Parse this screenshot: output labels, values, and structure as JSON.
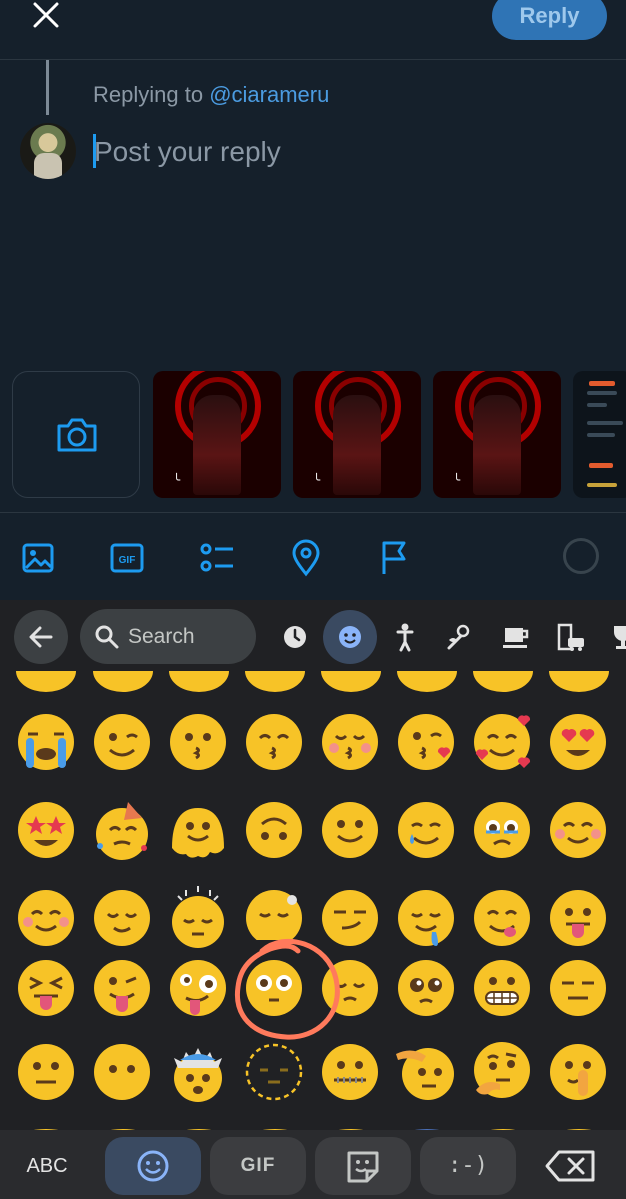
{
  "header": {
    "close_label": "✕",
    "reply_button": "Reply"
  },
  "reply": {
    "replying_prefix": "Replying to ",
    "replying_handle": "@ciarameru",
    "placeholder": "Post your reply"
  },
  "media_strip": {
    "camera_icon": "camera-icon",
    "thumbnails": [
      {
        "icon": "image"
      },
      {
        "icon": "image"
      },
      {
        "icon": "image"
      }
    ]
  },
  "toolbar": {
    "icons": [
      "image-icon",
      "gif-icon",
      "poll-icon",
      "location-icon",
      "flag-icon"
    ],
    "gif_text": "GIF"
  },
  "keyboard": {
    "search_placeholder": "Search",
    "categories": [
      "recent",
      "smileys",
      "people",
      "nature",
      "food",
      "travel",
      "activities"
    ],
    "selected_category": "smileys",
    "emoji_rows": [
      [
        "😭",
        "😉",
        "😗",
        "😙",
        "😚",
        "😘",
        "🥰",
        "😍"
      ],
      [
        "🤩",
        "🥳",
        "🫠",
        "🙃",
        "🙂",
        "🥲",
        "🥹",
        "😊"
      ],
      [
        "☺️",
        "😌",
        "😔",
        "😴",
        "😏",
        "🤤",
        "😋",
        "😛"
      ],
      [
        "😝",
        "😜",
        "🤪",
        "😳",
        "😌",
        "🥺",
        "😬",
        "😑"
      ],
      [
        "😐",
        "😶",
        "🤯",
        "🫥",
        "🤐",
        "🫡",
        "🤔",
        "🤫"
      ]
    ],
    "abc_label": "ABC",
    "gif_label": "GIF",
    "emoticon_label": ":-)",
    "accent": "#8ab4f8"
  },
  "colors": {
    "background": "#15202b",
    "accent": "#1d9bf0",
    "keyboard_bg": "#202124",
    "annotation": "#ff7a5c"
  }
}
